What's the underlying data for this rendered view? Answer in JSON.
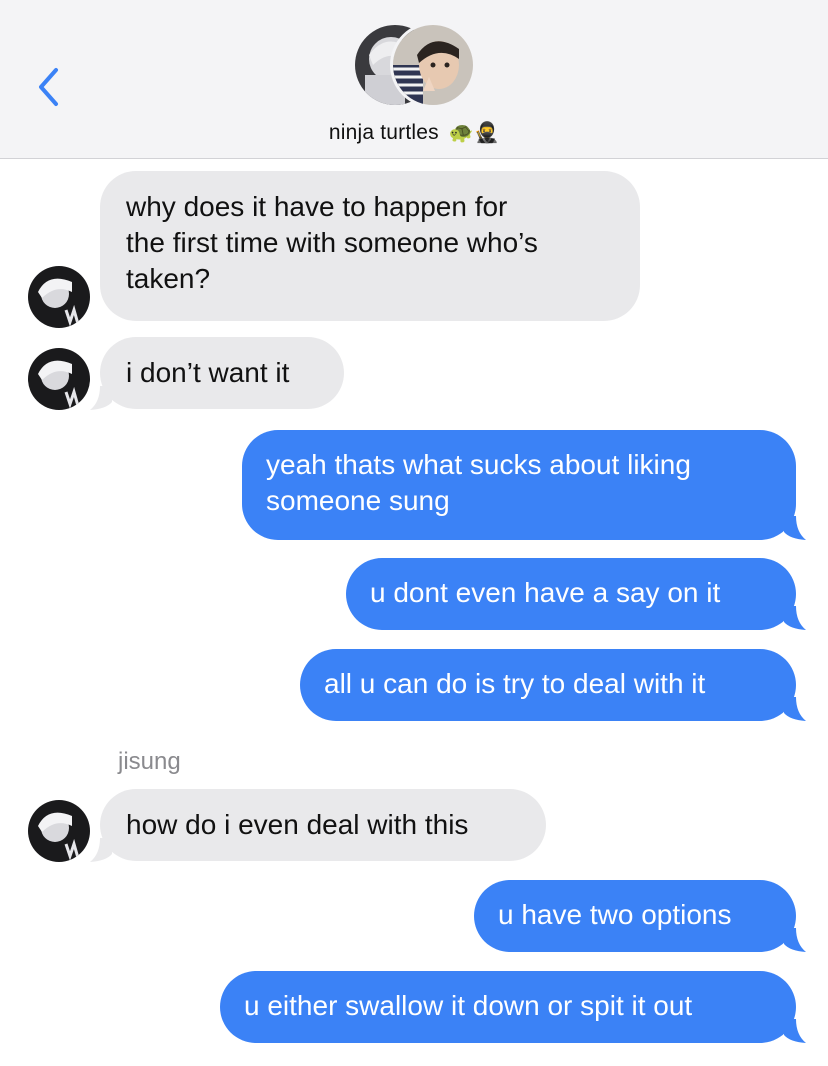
{
  "header": {
    "group_name": "ninja turtles",
    "emojis": "🐢🥷",
    "accent_color": "#3b82f6",
    "back_icon": "chevron-left-icon"
  },
  "messages": [
    {
      "dir": "in",
      "text": "why does it have to happen for\nthe first time with someone who’s\ntaken?"
    },
    {
      "dir": "in",
      "text": "i don’t want it"
    },
    {
      "dir": "out",
      "text": "yeah thats what sucks about liking\nsomeone sung"
    },
    {
      "dir": "out",
      "text": "u dont even have a say on it"
    },
    {
      "dir": "out",
      "text": "all u can do is try to deal with it"
    },
    {
      "dir": "in",
      "sender": "jisung",
      "text": "how do i even deal with this"
    },
    {
      "dir": "out",
      "text": "u have two options"
    },
    {
      "dir": "out",
      "text": "u either swallow it down or spit it out"
    }
  ],
  "colors": {
    "incoming_bubble": "#e9e9eb",
    "outgoing_bubble": "#3b82f6",
    "header_bg": "#f4f4f6"
  }
}
